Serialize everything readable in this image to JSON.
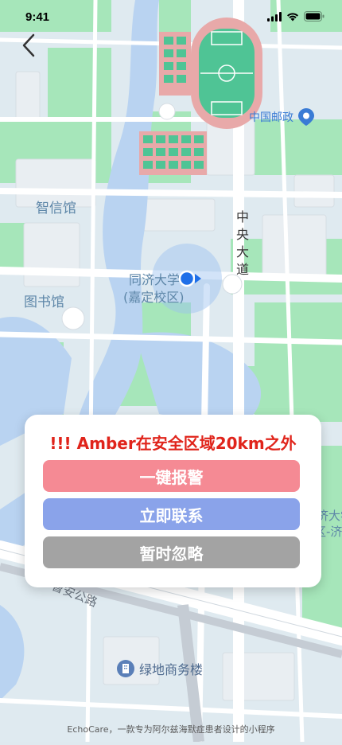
{
  "status_bar": {
    "time": "9:41"
  },
  "map": {
    "labels": {
      "zhixin": "智信馆",
      "library": "图书馆",
      "campus_line1": "同济大学",
      "campus_line2": "(嘉定校区)",
      "avenue": "中央大道",
      "post": "中国邮政",
      "road": "曹安公路",
      "plaza": "绿地商务楼",
      "right_campus1": "同济大学",
      "right_campus2": "校区-济"
    }
  },
  "alert": {
    "title": "!!! Amber在安全区域20km之外",
    "buttons": {
      "alarm": "一键报警",
      "contact": "立即联系",
      "ignore": "暂时忽略"
    },
    "colors": {
      "alarm": "#f58a94",
      "contact": "#8aa3ea",
      "ignore": "#a3a3a3",
      "title": "#e0241b"
    }
  },
  "footer": {
    "text": "EchoCare，一款专为阿尔兹海默症患者设计的小程序"
  }
}
